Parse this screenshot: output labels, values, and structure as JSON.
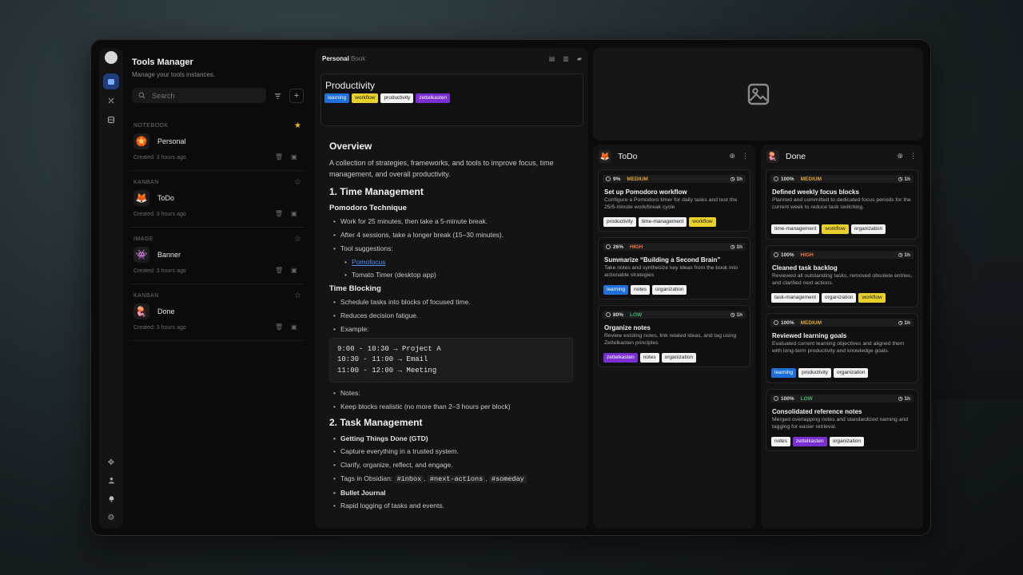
{
  "app": {
    "title": "Tools Manager",
    "subtitle": "Manage your tools instances.",
    "search_placeholder": "Search"
  },
  "notebooks": [
    {
      "type": "NOTEBOOK",
      "name": "Personal",
      "emoji": "🏵️",
      "created": "Created: 3 hours ago",
      "favorite": true
    },
    {
      "type": "KANBAN",
      "name": "ToDo",
      "emoji": "🦊",
      "created": "Created: 3 hours ago",
      "favorite": false
    },
    {
      "type": "IMAGE",
      "name": "Banner",
      "emoji": "👾",
      "created": "Created: 3 hours ago",
      "favorite": false
    },
    {
      "type": "KANBAN",
      "name": "Done",
      "emoji": "🪼",
      "created": "Created: 3 hours ago",
      "favorite": false
    }
  ],
  "doc": {
    "notebook": "Personal",
    "section": "Book",
    "title": "Productivity",
    "tags": [
      "learning",
      "workflow",
      "productivity",
      "zettelkasten"
    ],
    "overview_heading": "Overview",
    "overview_text": "A collection of strategies, frameworks, and tools to improve focus, time management, and overall productivity.",
    "h_time": "1. Time Management",
    "h_pomodoro": "Pomodoro Technique",
    "pomodoro_items": [
      "Work for 25 minutes, then take a 5-minute break.",
      "After 4 sessions, take a longer break (15–30 minutes).",
      "Tool suggestions:"
    ],
    "tool_items": [
      "Pomofocus",
      "Tomato Timer (desktop app)"
    ],
    "h_blocking": "Time Blocking",
    "blocking_items": [
      "Schedule tasks into blocks of focused time.",
      "Reduces decision fatigue.",
      "Example:"
    ],
    "code_lines": [
      "9:00 - 10:30 → Project A",
      "10:30 - 11:00 → Email",
      "11:00 - 12:00 → Meeting"
    ],
    "after_code_items": [
      "Notes:",
      "Keep blocks realistic (no more than 2–3 hours per block)"
    ],
    "h_task": "2. Task Management",
    "gtd_label": "Getting Things Done (GTD)",
    "gtd_items": [
      "Capture everything in a trusted system.",
      "Clarify, organize, reflect, and engage."
    ],
    "tags_label": "Tags in Obsidian:",
    "obsidian_tags": [
      "#inbox",
      "#next-actions",
      "#someday"
    ],
    "bullet_label": "Bullet Journal",
    "bullet_items": [
      "Rapid logging of tasks and events."
    ]
  },
  "columns": {
    "todo": {
      "title": "ToDo",
      "emoji": "🦊",
      "cards": [
        {
          "progress": "9%",
          "priority": "MEDIUM",
          "estimate": "1h",
          "title": "Set up Pomodoro workflow",
          "desc": "Configure a Pomodoro timer for daily tasks and test the 25/5-minute work/break cycle",
          "tags": [
            "productivity",
            "time-management",
            "workflow"
          ]
        },
        {
          "progress": "26%",
          "priority": "HIGH",
          "estimate": "1h",
          "title": "Summarize “Building a Second Brain”",
          "desc": "Take notes and synthesize key ideas from the book into actionable strategies",
          "tags": [
            "learning",
            "notes",
            "organization"
          ]
        },
        {
          "progress": "80%",
          "priority": "LOW",
          "estimate": "1h",
          "title": "Organize notes",
          "desc": "Review existing notes, link related ideas, and tag using Zettelkasten principles",
          "tags": [
            "zettelkasten",
            "notes",
            "organization"
          ]
        }
      ]
    },
    "done": {
      "title": "Done",
      "emoji": "🪼",
      "cards": [
        {
          "progress": "100%",
          "priority": "MEDIUM",
          "estimate": "1h",
          "title": "Defined weekly focus blocks",
          "desc": "Planned and committed to dedicated focus periods for the current week to reduce task switching.",
          "tags": [
            "time-management",
            "workflow",
            "organization"
          ]
        },
        {
          "progress": "100%",
          "priority": "HIGH",
          "estimate": "1h",
          "title": "Cleaned task backlog",
          "desc": "Reviewed all outstanding tasks, removed obsolete entries, and clarified next actions.",
          "tags": [
            "task-management",
            "organization",
            "workflow"
          ]
        },
        {
          "progress": "100%",
          "priority": "MEDIUM",
          "estimate": "1h",
          "title": "Reviewed learning goals",
          "desc": "Evaluated current learning objectives and aligned them with long-term productivity and knowledge goals.",
          "tags": [
            "learning",
            "productivity",
            "organization"
          ]
        },
        {
          "progress": "100%",
          "priority": "LOW",
          "estimate": "1h",
          "title": "Consolidated reference notes",
          "desc": "Merged overlapping notes and standardized naming and tagging for easier retrieval.",
          "tags": [
            "notes",
            "zettelkasten",
            "organization"
          ]
        }
      ]
    }
  },
  "tag_colors": {
    "learning": "#1f6fd8",
    "workflow": "#e8d12b",
    "zettelkasten": "#7a2fd0",
    "default": "#f2f2f2"
  },
  "icons": {
    "rail": [
      "app-logo-icon",
      "notebooks-icon",
      "tools-icon",
      "storage-icon",
      "move-icon",
      "user-icon",
      "bell-icon",
      "settings-icon"
    ],
    "doc_toolbar": [
      "file-icon",
      "file-icon",
      "folder-icon"
    ],
    "banner": "image-placeholder-icon"
  }
}
